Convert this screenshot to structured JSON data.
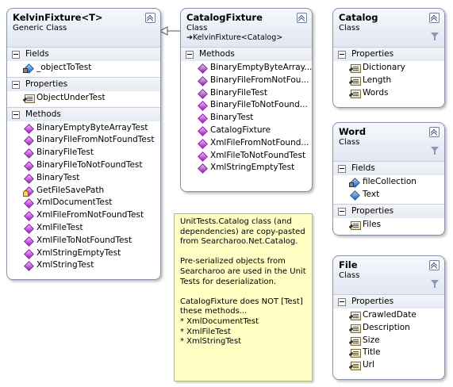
{
  "kelvin": {
    "title": "KelvinFixture<T>",
    "subtitle": "Generic Class",
    "sections": [
      {
        "label": "Fields",
        "items": [
          {
            "text": "_objectToTest",
            "icon": "field-private"
          }
        ]
      },
      {
        "label": "Properties",
        "items": [
          {
            "text": "ObjectUnderTest",
            "icon": "property"
          }
        ]
      },
      {
        "label": "Methods",
        "items": [
          {
            "text": "BinaryEmptyByteArrayTest",
            "icon": "method"
          },
          {
            "text": "BinaryFileFromNotFoundTest",
            "icon": "method"
          },
          {
            "text": "BinaryFileTest",
            "icon": "method"
          },
          {
            "text": "BinaryFileToNotFoundTest",
            "icon": "method"
          },
          {
            "text": "BinaryTest",
            "icon": "method"
          },
          {
            "text": "GetFileSavePath",
            "icon": "method-protected"
          },
          {
            "text": "XmlDocumentTest",
            "icon": "method"
          },
          {
            "text": "XmlFileFromNotFoundTest",
            "icon": "method"
          },
          {
            "text": "XmlFileTest",
            "icon": "method"
          },
          {
            "text": "XmlFileToNotFoundTest",
            "icon": "method"
          },
          {
            "text": "XmlStringEmptyTest",
            "icon": "method"
          },
          {
            "text": "XmlStringTest",
            "icon": "method"
          }
        ]
      }
    ]
  },
  "catalogFixture": {
    "title": "CatalogFixture",
    "subtitle": "Class",
    "inherits": "➔KelvinFixture<Catalog>",
    "sections": [
      {
        "label": "Methods",
        "items": [
          {
            "text": "BinaryEmptyByteArray...",
            "icon": "method"
          },
          {
            "text": "BinaryFileFromNotFou...",
            "icon": "method"
          },
          {
            "text": "BinaryFileTest",
            "icon": "method"
          },
          {
            "text": "BinaryFileToNotFound...",
            "icon": "method"
          },
          {
            "text": "BinaryTest",
            "icon": "method"
          },
          {
            "text": "CatalogFixture",
            "icon": "method"
          },
          {
            "text": "XmlFileFromNotFound...",
            "icon": "method"
          },
          {
            "text": "XmlFileToNotFoundTest",
            "icon": "method"
          },
          {
            "text": "XmlStringEmptyTest",
            "icon": "method"
          }
        ]
      }
    ]
  },
  "catalog": {
    "title": "Catalog",
    "subtitle": "Class",
    "sections": [
      {
        "label": "Properties",
        "items": [
          {
            "text": "Dictionary",
            "icon": "property"
          },
          {
            "text": "Length",
            "icon": "property"
          },
          {
            "text": "Words",
            "icon": "property"
          }
        ]
      }
    ]
  },
  "word": {
    "title": "Word",
    "subtitle": "Class",
    "sections": [
      {
        "label": "Fields",
        "items": [
          {
            "text": "fileCollection",
            "icon": "field-private"
          },
          {
            "text": "Text",
            "icon": "field"
          }
        ]
      },
      {
        "label": "Properties",
        "items": [
          {
            "text": "Files",
            "icon": "property"
          }
        ]
      }
    ]
  },
  "file": {
    "title": "File",
    "subtitle": "Class",
    "sections": [
      {
        "label": "Properties",
        "items": [
          {
            "text": "CrawledDate",
            "icon": "property"
          },
          {
            "text": "Description",
            "icon": "property"
          },
          {
            "text": "Size",
            "icon": "property"
          },
          {
            "text": "Title",
            "icon": "property"
          },
          {
            "text": "Url",
            "icon": "property"
          }
        ]
      }
    ]
  },
  "note": {
    "paragraphs": [
      [
        "UnitTests.Catalog class (and",
        "dependencies) are copy-pasted",
        "from Searcharoo.Net.Catalog."
      ],
      [
        "Pre-serialized objects from",
        "Searcharoo are used in the Unit",
        "Tests for deserialization."
      ],
      [
        "CatalogFixture does NOT [Test]",
        "these methods...",
        "* XmlDocumentTest",
        "* XmlFileTest",
        "* XmlStringTest"
      ]
    ]
  }
}
